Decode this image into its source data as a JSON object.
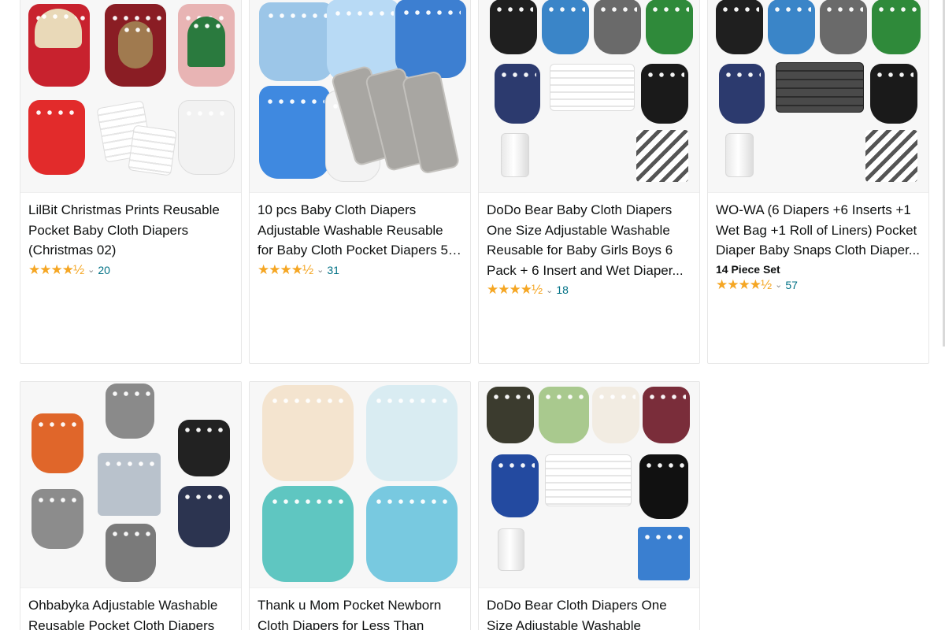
{
  "products": [
    {
      "title": "LilBit Christmas Prints Reusable Pocket Baby Cloth Diapers (Christmas 02)",
      "stars": "★★★★½",
      "reviews": "20",
      "badge": ""
    },
    {
      "title": "10 pcs Baby Cloth Diapers Adjustable Washable Reusable for Baby Cloth Pocket Diapers 5 Pac...",
      "stars": "★★★★½",
      "reviews": "31",
      "badge": ""
    },
    {
      "title": "DoDo Bear Baby Cloth Diapers One Size Adjustable Washable Reusable for Baby Girls Boys 6 Pack + 6 Insert and Wet Diaper...",
      "stars": "★★★★½",
      "reviews": "18",
      "badge": ""
    },
    {
      "title": "WO-WA (6 Diapers +6 Inserts +1 Wet Bag +1 Roll of Liners) Pocket Diaper Baby Snaps Cloth Diaper...",
      "stars": "★★★★½",
      "reviews": "57",
      "badge": "14 Piece Set"
    },
    {
      "title": "Ohbabyka Adjustable Washable Reusable Pocket Cloth Diapers",
      "stars": "",
      "reviews": "",
      "badge": ""
    },
    {
      "title": "Thank u Mom Pocket Newborn Cloth Diapers for Less Than",
      "stars": "",
      "reviews": "",
      "badge": ""
    },
    {
      "title": "DoDo Bear Cloth Diapers One Size Adjustable Washable Reusable for",
      "stars": "",
      "reviews": "",
      "badge": ""
    }
  ],
  "icons": {
    "star": "star-rating-icon",
    "chevron": "chevron-down-icon"
  },
  "colors": {
    "star": "#f5a623",
    "link": "#007185",
    "text": "#0f1111"
  }
}
